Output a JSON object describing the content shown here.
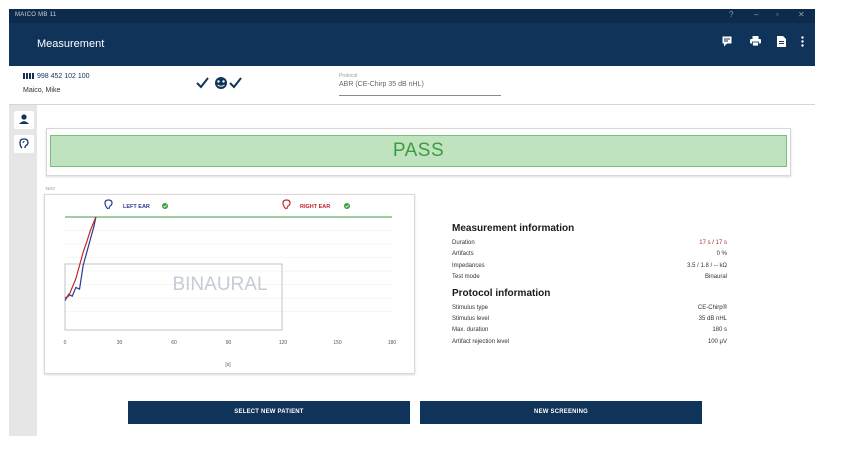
{
  "window": {
    "app_title": "MAICO MB 11"
  },
  "appbar": {
    "title": "Measurement",
    "icons": [
      "feedback-icon",
      "print-icon",
      "export-icon",
      "more-icon"
    ]
  },
  "patient": {
    "id": "998 452 102 100",
    "name": "Maico, Mike"
  },
  "protocol": {
    "label": "Protocol",
    "value": "ABR (CE-Chirp 35 dB nHL)"
  },
  "sidebar": {
    "icons": [
      "patient-icon",
      "ear-icon"
    ]
  },
  "result": {
    "label": "PASS"
  },
  "test_label": "TEST",
  "chart": {
    "left_ear": "LEFT EAR",
    "right_ear": "RIGHT EAR",
    "watermark": "BINAURAL",
    "x_unit": "[s]",
    "colors": {
      "left": "#2b3a8f",
      "right": "#c0262d",
      "pass": "#3f9b3f"
    }
  },
  "chart_data": {
    "type": "line",
    "title": "",
    "xlabel": "[s]",
    "ylabel": "",
    "xlim": [
      0,
      180
    ],
    "x_ticks": [
      "0",
      "30",
      "60",
      "90",
      "120",
      "150",
      "180"
    ],
    "series": [
      {
        "name": "LEFT EAR",
        "color": "#2b3a8f",
        "x": [
          0,
          2,
          4,
          6,
          8,
          10,
          12,
          14,
          16,
          17
        ],
        "y": [
          0.05,
          0.12,
          0.1,
          0.2,
          0.18,
          0.45,
          0.6,
          0.75,
          0.9,
          1.0
        ]
      },
      {
        "name": "RIGHT EAR",
        "color": "#c0262d",
        "x": [
          0,
          2,
          4,
          6,
          8,
          10,
          12,
          14,
          16,
          17
        ],
        "y": [
          0.08,
          0.1,
          0.2,
          0.3,
          0.45,
          0.6,
          0.72,
          0.85,
          0.95,
          1.0
        ]
      }
    ],
    "pass_line": 1.0,
    "grid": true
  },
  "measurement_info": {
    "title": "Measurement information",
    "rows": [
      {
        "key": "Duration",
        "value_a": "17 s",
        "sep": " / ",
        "value_b": "17 s"
      },
      {
        "key": "Artifacts",
        "value": "0 %"
      },
      {
        "key": "Impedances",
        "value": "3.5 / 1.8 / -- kΩ"
      },
      {
        "key": "Test mode",
        "value": "Binaural"
      }
    ]
  },
  "protocol_info": {
    "title": "Protocol information",
    "rows": [
      {
        "key": "Stimulus type",
        "value": "CE-Chirp®"
      },
      {
        "key": "Stimulus level",
        "value": "35 dB nHL"
      },
      {
        "key": "Max. duration",
        "value": "180 s"
      },
      {
        "key": "Artifact rejection level",
        "value": "100 µV"
      }
    ]
  },
  "buttons": {
    "select_patient": "SELECT NEW PATIENT",
    "new_screening": "NEW SCREENING"
  }
}
